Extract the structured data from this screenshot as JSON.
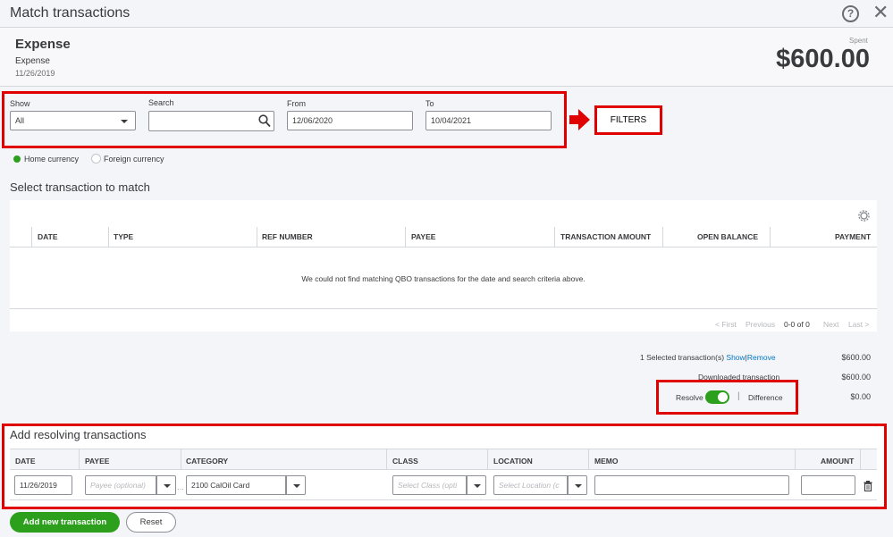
{
  "dialog": {
    "title": "Match transactions"
  },
  "header": {
    "type_title": "Expense",
    "type_sub": "Expense",
    "date": "11/26/2019",
    "spent_label": "Spent",
    "amount": "$600.00"
  },
  "filters": {
    "show_label": "Show",
    "show_value": "All",
    "search_label": "Search",
    "search_value": "",
    "from_label": "From",
    "from_value": "12/06/2020",
    "to_label": "To",
    "to_value": "10/04/2021",
    "callout": "FILTERS"
  },
  "currency": {
    "home": "Home currency",
    "foreign": "Foreign currency",
    "selected": "home"
  },
  "match_table": {
    "title": "Select transaction to match",
    "columns": [
      "DATE",
      "TYPE",
      "REF NUMBER",
      "PAYEE",
      "TRANSACTION AMOUNT",
      "OPEN BALANCE",
      "PAYMENT"
    ],
    "empty_message": "We could not find matching QBO transactions for the date and search criteria above.",
    "pager": {
      "first": "< First",
      "previous": "Previous",
      "range": "0-0 of 0",
      "next": "Next",
      "last": "Last >"
    }
  },
  "summary": {
    "selected_label": "1 Selected transaction(s)",
    "show_link": "Show",
    "separator": "|",
    "remove_link": "Remove",
    "selected_value": "$600.00",
    "downloaded_label": "Downloaded transaction",
    "downloaded_value": "$600.00",
    "resolve_label": "Resolve",
    "difference_label": "Difference",
    "difference_value": "$0.00",
    "resolve_on": true
  },
  "resolving": {
    "title": "Add resolving transactions",
    "columns": [
      "DATE",
      "PAYEE",
      "CATEGORY",
      "CLASS",
      "LOCATION",
      "MEMO",
      "AMOUNT"
    ],
    "row": {
      "date": "11/26/2019",
      "payee_placeholder": "Payee (optional)",
      "category": "2100 CalOil Card",
      "class_placeholder": "Select Class (opti",
      "location_placeholder": "Select Location (c",
      "memo": "",
      "amount": ""
    }
  },
  "actions": {
    "add_new": "Add new transaction",
    "reset": "Reset"
  },
  "colors": {
    "accent_green": "#2ca01c",
    "annotation_red": "#e00000",
    "link_blue": "#0077c5"
  }
}
